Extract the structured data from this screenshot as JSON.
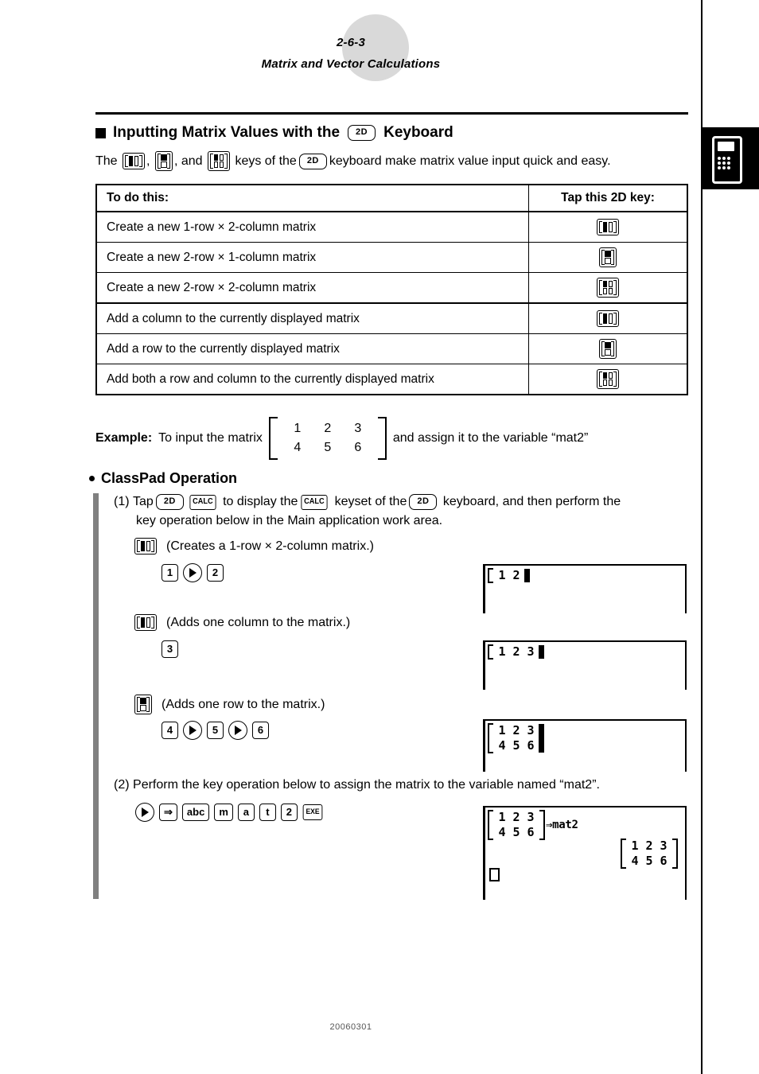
{
  "header": {
    "page_number": "2-6-3",
    "title": "Matrix and Vector Calculations"
  },
  "side_tab": {
    "icon": "calculator-icon"
  },
  "section": {
    "heading_before": "Inputting Matrix Values with the",
    "heading_key": "2D",
    "heading_after": "Keyboard",
    "intro_1": "The",
    "intro_2": ",",
    "intro_3": ", and",
    "intro_4": "keys of the",
    "intro_key": "2D",
    "intro_5": "keyboard make matrix value input quick and easy."
  },
  "table": {
    "headers": [
      "To do this:",
      "Tap this 2D key:"
    ],
    "rows": [
      {
        "desc": "Create a new 1-row × 2-column matrix",
        "key": "matrix-1x2-key"
      },
      {
        "desc": "Create a new 2-row × 1-column matrix",
        "key": "matrix-2x1-key"
      },
      {
        "desc": "Create a new 2-row × 2-column matrix",
        "key": "matrix-2x2-key"
      },
      {
        "desc": "Add a column to the currently displayed matrix",
        "key": "matrix-1x2-key"
      },
      {
        "desc": "Add a row to the currently displayed matrix",
        "key": "matrix-2x1-key"
      },
      {
        "desc": "Add both a row and column to the currently displayed matrix",
        "key": "matrix-2x2-key"
      }
    ]
  },
  "example": {
    "label": "Example:",
    "text_before": "To input the matrix",
    "matrix": [
      [
        "1",
        "2",
        "3"
      ],
      [
        "4",
        "5",
        "6"
      ]
    ],
    "text_after": "and assign it to the variable “mat2”"
  },
  "classpad": {
    "heading": "ClassPad Operation",
    "step1": {
      "number": "(1)",
      "t1": "Tap",
      "key_2d": "2D",
      "key_calc": "CALC",
      "t2": "to display the",
      "key_calc2": "CALC",
      "t3": "keyset of the",
      "key_2d2": "2D",
      "t4": "keyboard, and then perform the",
      "line2": "key operation below in the Main application work area."
    },
    "actions": [
      {
        "key": "matrix-1x2-key",
        "caption": "(Creates a 1-row × 2-column matrix.)",
        "keys": [
          "1",
          "right-arrow",
          "2"
        ]
      },
      {
        "key": "matrix-1x2-key",
        "caption": "(Adds one column to the matrix.)",
        "keys": [
          "3"
        ]
      },
      {
        "key": "matrix-2x1-key",
        "caption": "(Adds one row to the matrix.)",
        "keys": [
          "4",
          "right-arrow",
          "5",
          "right-arrow",
          "6"
        ]
      }
    ],
    "step2": {
      "number": "(2)",
      "text": "Perform the key operation below to assign the matrix to the variable named “mat2”.",
      "keys": [
        "right-arrow",
        "assign-arrow",
        "abc",
        "m",
        "a",
        "t",
        "2",
        "EXE"
      ]
    }
  },
  "lcd_screens": [
    {
      "name": "lcd-1row-2col",
      "matrix": [
        [
          "1",
          "2"
        ]
      ],
      "assign": "",
      "result": null
    },
    {
      "name": "lcd-1row-3col",
      "matrix": [
        [
          "1",
          "2",
          "3"
        ]
      ],
      "assign": "",
      "result": null
    },
    {
      "name": "lcd-2row-3col",
      "matrix": [
        [
          "1",
          "2",
          "3"
        ],
        [
          "4",
          "5",
          "6"
        ]
      ],
      "assign": "",
      "result": null
    },
    {
      "name": "lcd-assigned",
      "matrix": [
        [
          "1",
          "2",
          "3"
        ],
        [
          "4",
          "5",
          "6"
        ]
      ],
      "assign": "⇒mat2",
      "result": [
        [
          "1",
          "2",
          "3"
        ],
        [
          "4",
          "5",
          "6"
        ]
      ]
    }
  ],
  "footer": {
    "code": "20060301"
  },
  "glyphs": {
    "assign_arrow": "⇒",
    "times": "×",
    "exe": "EXE",
    "abc": "abc"
  }
}
